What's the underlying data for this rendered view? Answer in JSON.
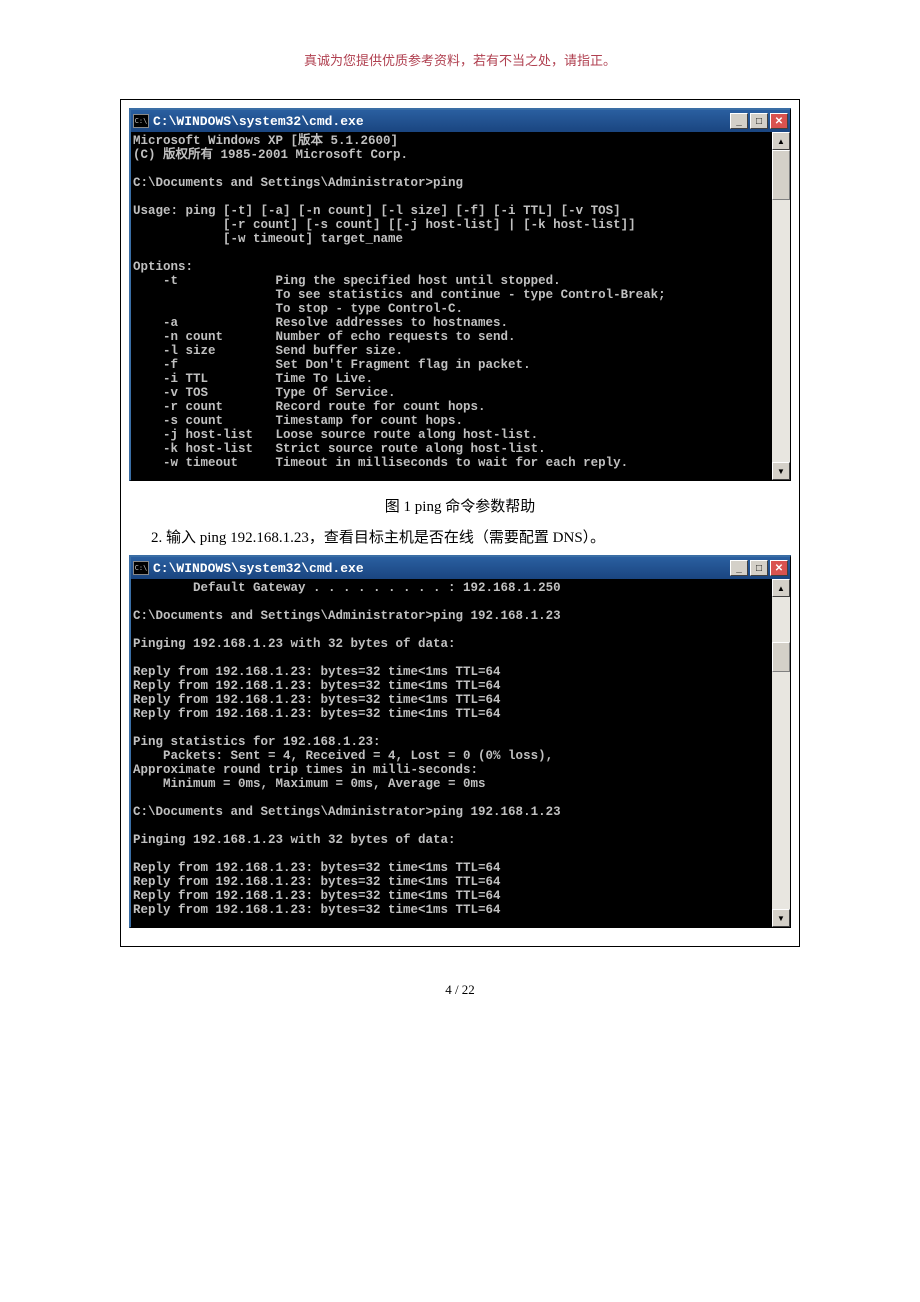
{
  "doc_header": "真诚为您提供优质参考资料，若有不当之处，请指正。",
  "win1": {
    "title": "C:\\WINDOWS\\system32\\cmd.exe",
    "icon_text": "C:\\",
    "btn_min": "_",
    "btn_max": "□",
    "btn_close": "✕",
    "sb_up": "▲",
    "sb_down": "▼",
    "term": "Microsoft Windows XP [版本 5.1.2600]\n(C) 版权所有 1985-2001 Microsoft Corp.\n\nC:\\Documents and Settings\\Administrator>ping\n\nUsage: ping [-t] [-a] [-n count] [-l size] [-f] [-i TTL] [-v TOS]\n            [-r count] [-s count] [[-j host-list] | [-k host-list]]\n            [-w timeout] target_name\n\nOptions:\n    -t             Ping the specified host until stopped.\n                   To see statistics and continue - type Control-Break;\n                   To stop - type Control-C.\n    -a             Resolve addresses to hostnames.\n    -n count       Number of echo requests to send.\n    -l size        Send buffer size.\n    -f             Set Don't Fragment flag in packet.\n    -i TTL         Time To Live.\n    -v TOS         Type Of Service.\n    -r count       Record route for count hops.\n    -s count       Timestamp for count hops.\n    -j host-list   Loose source route along host-list.\n    -k host-list   Strict source route along host-list.\n    -w timeout     Timeout in milliseconds to wait for each reply.\n"
  },
  "caption1": "图 1 ping 命令参数帮助",
  "instruction": "2.   输入 ping 192.168.1.23，查看目标主机是否在线（需要配置 DNS）。",
  "win2": {
    "title": "C:\\WINDOWS\\system32\\cmd.exe",
    "term": "        Default Gateway . . . . . . . . . : 192.168.1.250\n\nC:\\Documents and Settings\\Administrator>ping 192.168.1.23\n\nPinging 192.168.1.23 with 32 bytes of data:\n\nReply from 192.168.1.23: bytes=32 time<1ms TTL=64\nReply from 192.168.1.23: bytes=32 time<1ms TTL=64\nReply from 192.168.1.23: bytes=32 time<1ms TTL=64\nReply from 192.168.1.23: bytes=32 time<1ms TTL=64\n\nPing statistics for 192.168.1.23:\n    Packets: Sent = 4, Received = 4, Lost = 0 (0% loss),\nApproximate round trip times in milli-seconds:\n    Minimum = 0ms, Maximum = 0ms, Average = 0ms\n\nC:\\Documents and Settings\\Administrator>ping 192.168.1.23\n\nPinging 192.168.1.23 with 32 bytes of data:\n\nReply from 192.168.1.23: bytes=32 time<1ms TTL=64\nReply from 192.168.1.23: bytes=32 time<1ms TTL=64\nReply from 192.168.1.23: bytes=32 time<1ms TTL=64\nReply from 192.168.1.23: bytes=32 time<1ms TTL=64\n"
  },
  "page_number": "4  /  22"
}
